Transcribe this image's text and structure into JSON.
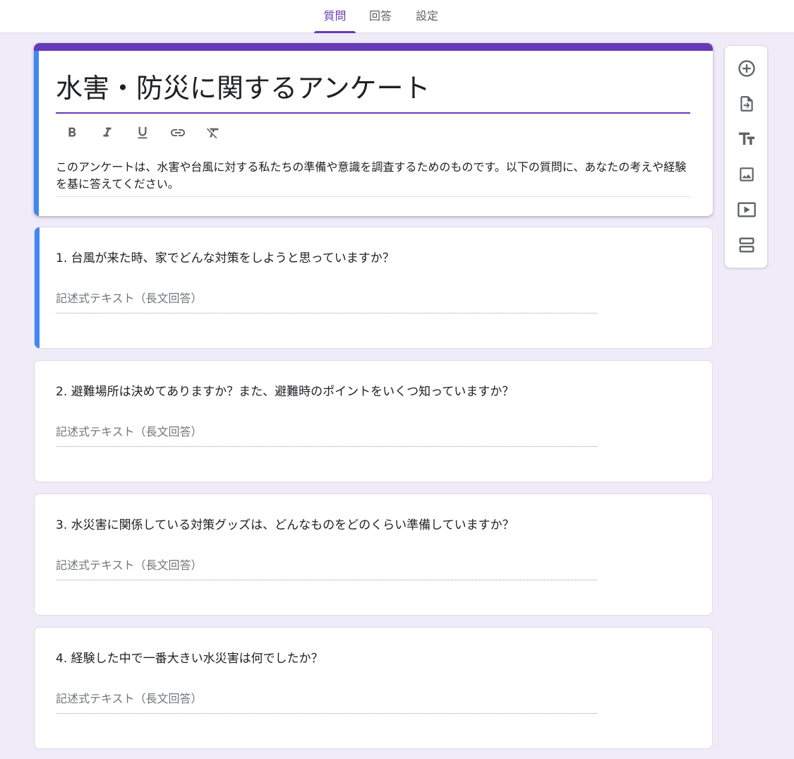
{
  "tabs": [
    {
      "label": "質問"
    },
    {
      "label": "回答"
    },
    {
      "label": "設定"
    }
  ],
  "form": {
    "title": "水害・防災に関するアンケート",
    "description": "このアンケートは、水害や台風に対する私たちの準備や意識を調査するためのものです。以下の質問に、あなたの考えや経験を基に答えてください。"
  },
  "questions": [
    {
      "title": "1. 台風が来た時、家でどんな対策をしようと思っていますか？",
      "placeholder": "記述式テキスト（長文回答）"
    },
    {
      "title": "2. 避難場所は決めてありますか？また、避難時のポイントをいくつ知っていますか？",
      "placeholder": "記述式テキスト（長文回答）"
    },
    {
      "title": "3. 水災害に関係している対策グッズは、どんなものをどのくらい準備していますか？",
      "placeholder": "記述式テキスト（長文回答）"
    },
    {
      "title": "4. 経験した中で一番大きい水災害は何でしたか？",
      "placeholder": "記述式テキスト（長文回答）"
    }
  ],
  "toolbar_icons": [
    "bold-icon",
    "italic-icon",
    "underline-icon",
    "link-icon",
    "clear-format-icon"
  ],
  "sidebar_icons": [
    "add-question-icon",
    "import-questions-icon",
    "add-title-icon",
    "add-image-icon",
    "add-video-icon",
    "add-section-icon"
  ],
  "colors": {
    "accent": "#673ab7",
    "focus": "#4285f4",
    "background": "#f0ebf8"
  }
}
